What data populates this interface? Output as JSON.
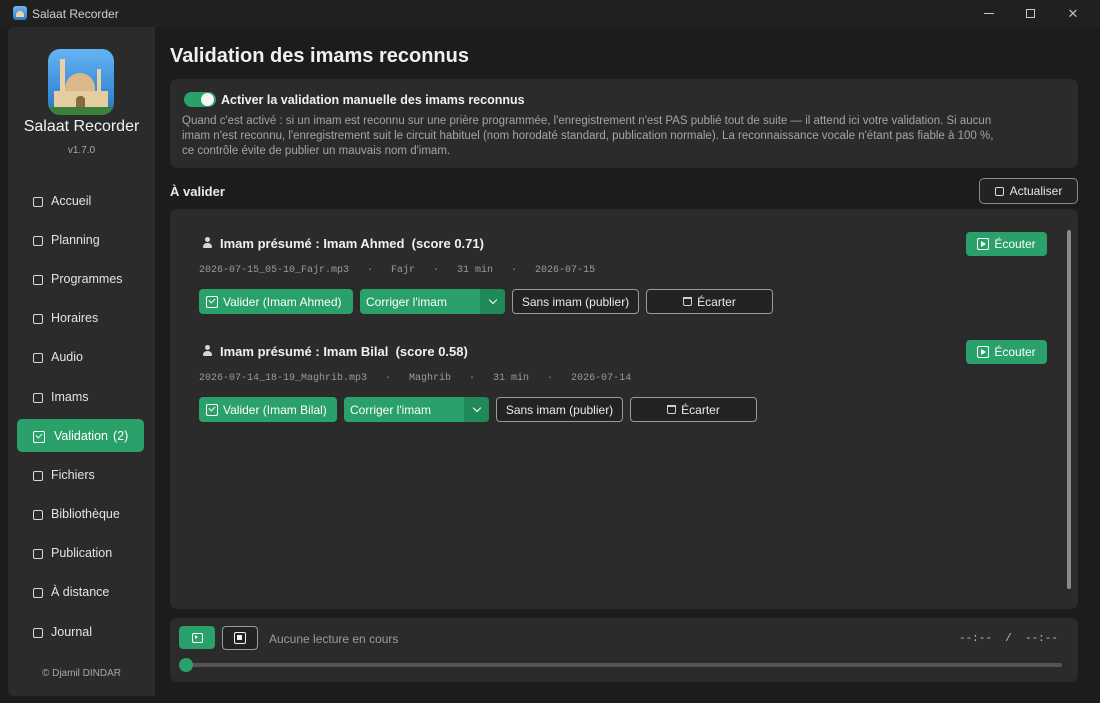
{
  "window": {
    "title": "Salaat Recorder"
  },
  "sidebar": {
    "app_name": "Salaat Recorder",
    "version": "v1.7.0",
    "items": [
      {
        "label": "Accueil",
        "icon": "home-icon"
      },
      {
        "label": "Planning",
        "icon": "calendar-icon"
      },
      {
        "label": "Programmes",
        "icon": "programs-icon"
      },
      {
        "label": "Horaires",
        "icon": "clock-icon"
      },
      {
        "label": "Audio",
        "icon": "audio-icon"
      },
      {
        "label": "Imams",
        "icon": "person-icon"
      },
      {
        "label": "Validation",
        "icon": "checkbox-icon",
        "badge": "(2)",
        "active": true
      },
      {
        "label": "Fichiers",
        "icon": "folder-icon"
      },
      {
        "label": "Bibliothèque",
        "icon": "library-icon"
      },
      {
        "label": "Publication",
        "icon": "globe-icon"
      },
      {
        "label": "À distance",
        "icon": "remote-icon"
      },
      {
        "label": "Journal",
        "icon": "log-icon"
      }
    ],
    "copyright": "© Djamil DINDAR"
  },
  "page": {
    "title": "Validation des imams reconnus",
    "toggle_label": "Activer la validation manuelle des imams reconnus",
    "toggle_on": true,
    "description": "Quand c'est activé : si un imam est reconnu sur une prière programmée, l'enregistrement n'est PAS publié tout de suite — il attend ici votre validation. Si aucun imam n'est reconnu, l'enregistrement suit le circuit habituel (nom horodaté standard, publication normale). La reconnaissance vocale n'étant pas fiable à 100 %, ce contrôle évite de publier un mauvais nom d'imam.",
    "section_title": "À valider",
    "refresh_label": "Actualiser"
  },
  "entries": [
    {
      "headline": "Imam présumé : Imam Ahmed  (score 0.71)",
      "meta": "2026-07-15_05-10_Fajr.mp3   ·   Fajr   ·   31 min   ·   2026-07-15",
      "listen_label": "Écouter",
      "validate_label": "Valider (Imam Ahmed)",
      "correct_label": "Corriger l'imam",
      "no_imam_label": "Sans imam (publier)",
      "discard_label": "Écarter"
    },
    {
      "headline": "Imam présumé : Imam Bilal  (score 0.58)",
      "meta": "2026-07-14_18-19_Maghrib.mp3   ·   Maghrib   ·   31 min   ·   2026-07-14",
      "listen_label": "Écouter",
      "validate_label": "Valider (Imam Bilal)",
      "correct_label": "Corriger l'imam",
      "no_imam_label": "Sans imam (publier)",
      "discard_label": "Écarter"
    }
  ],
  "player": {
    "status": "Aucune lecture en cours",
    "time": "--:--  /  --:--",
    "progress": 0
  },
  "colors": {
    "accent": "#2aa06a",
    "background": "#1c1c1c",
    "panel": "#2b2b2b"
  }
}
